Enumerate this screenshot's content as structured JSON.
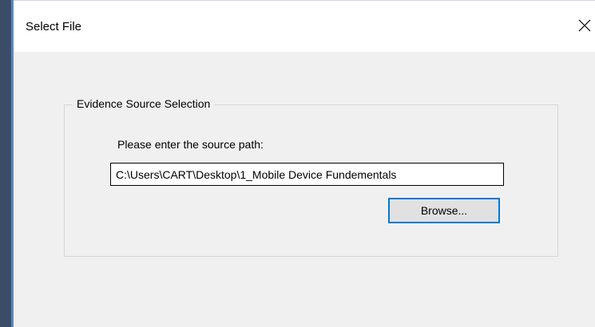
{
  "dialog": {
    "title": "Select File",
    "close_icon": "close-icon"
  },
  "group": {
    "title": "Evidence Source Selection",
    "prompt": "Please enter the source path:",
    "path_value": "C:\\Users\\CART\\Desktop\\1_Mobile Device Fundementals",
    "browse_label": "Browse..."
  },
  "colors": {
    "backdrop": "#3b4d66",
    "accent": "#0078d7",
    "dialog_bg": "#f0f0f0"
  }
}
